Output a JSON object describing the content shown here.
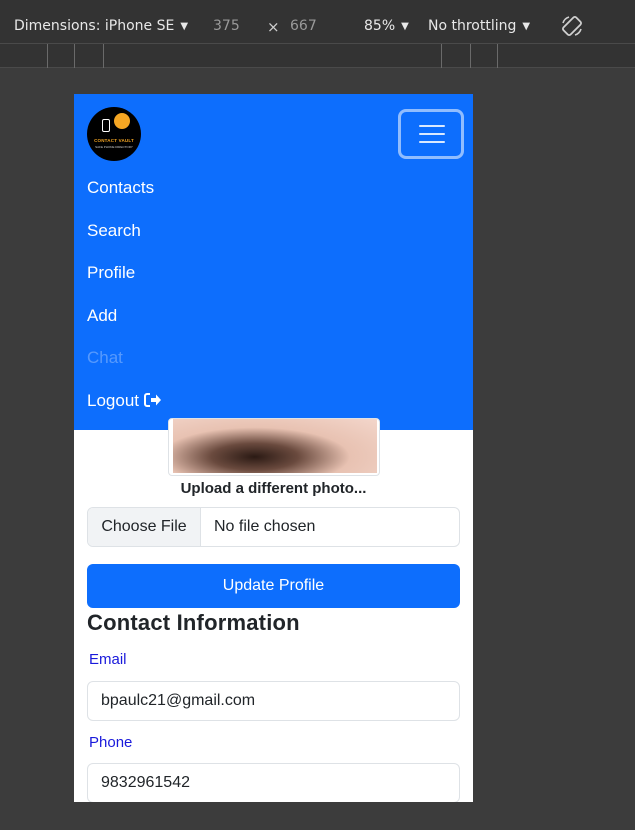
{
  "devtools": {
    "device_label": "Dimensions: iPhone SE",
    "width": "375",
    "times": "×",
    "height": "667",
    "zoom": "85%",
    "throttling": "No throttling",
    "caret": "▼"
  },
  "navbar": {
    "logo_text": "CONTACT VAULT",
    "logo_subtext": "SAFE PHONE DIRECTORY",
    "items": [
      {
        "label": "Contacts",
        "disabled": false
      },
      {
        "label": "Search",
        "disabled": false
      },
      {
        "label": "Profile",
        "disabled": false
      },
      {
        "label": "Add",
        "disabled": false
      },
      {
        "label": "Chat",
        "disabled": true
      },
      {
        "label": "Logout",
        "disabled": false
      }
    ]
  },
  "profile": {
    "upload_label": "Upload a different photo...",
    "file_button": "Choose File",
    "file_status": "No file chosen",
    "update_button": "Update Profile"
  },
  "contact": {
    "title": "Contact Information",
    "email_label": "Email",
    "email_value": "bpaulc21@gmail.com",
    "phone_label": "Phone",
    "phone_value": "9832961542"
  },
  "colors": {
    "primary": "#0d6efd",
    "label_blue": "#1a1adb",
    "devtools_bg": "#333333"
  }
}
